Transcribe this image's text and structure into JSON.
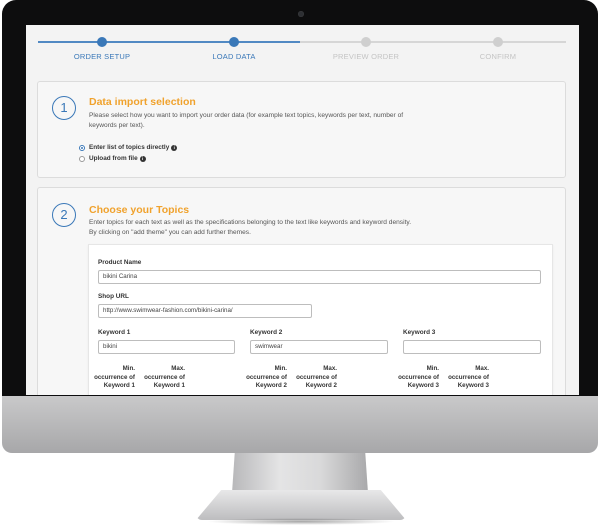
{
  "steps": [
    {
      "label": "ORDER SETUP",
      "state": "done"
    },
    {
      "label": "LOAD DATA",
      "state": "done"
    },
    {
      "label": "PREVIEW ORDER",
      "state": "todo"
    },
    {
      "label": "CONFIRM",
      "state": "todo"
    }
  ],
  "section1": {
    "number": "1",
    "title": "Data import selection",
    "description": "Please select how you want to import your order data (for example text topics, keywords per text, number of keywords per text).",
    "options": [
      {
        "label": "Enter list of topics directly",
        "selected": true
      },
      {
        "label": "Upload from file",
        "selected": false
      }
    ]
  },
  "section2": {
    "number": "2",
    "title": "Choose your Topics",
    "description": "Enter topics for each text as well as the specifications belonging to the text like keywords and keyword density. By clicking on \"add theme\" you can add further themes.",
    "product_name": {
      "label": "Product Name",
      "value": "bikini Carina"
    },
    "shop_url": {
      "label": "Shop URL",
      "value": "http://www.swimwear-fashion.com/bikini-carina/"
    },
    "keywords": [
      {
        "label": "Keyword 1",
        "value": "bikini",
        "min_label": "Min. occurrence of Keyword 1",
        "max_label": "Max. occurrence of Keyword 1"
      },
      {
        "label": "Keyword 2",
        "value": "swimwear",
        "min_label": "Min. occurrence of Keyword 2",
        "max_label": "Max. occurrence of Keyword 2"
      },
      {
        "label": "Keyword 3",
        "value": "",
        "min_label": "Min. occurrence of Keyword 3",
        "max_label": "Max. occurrence of Keyword 3"
      }
    ]
  },
  "colors": {
    "accent": "#3a78b8",
    "title": "#f0a22d",
    "inactive": "#c4c4c4"
  }
}
